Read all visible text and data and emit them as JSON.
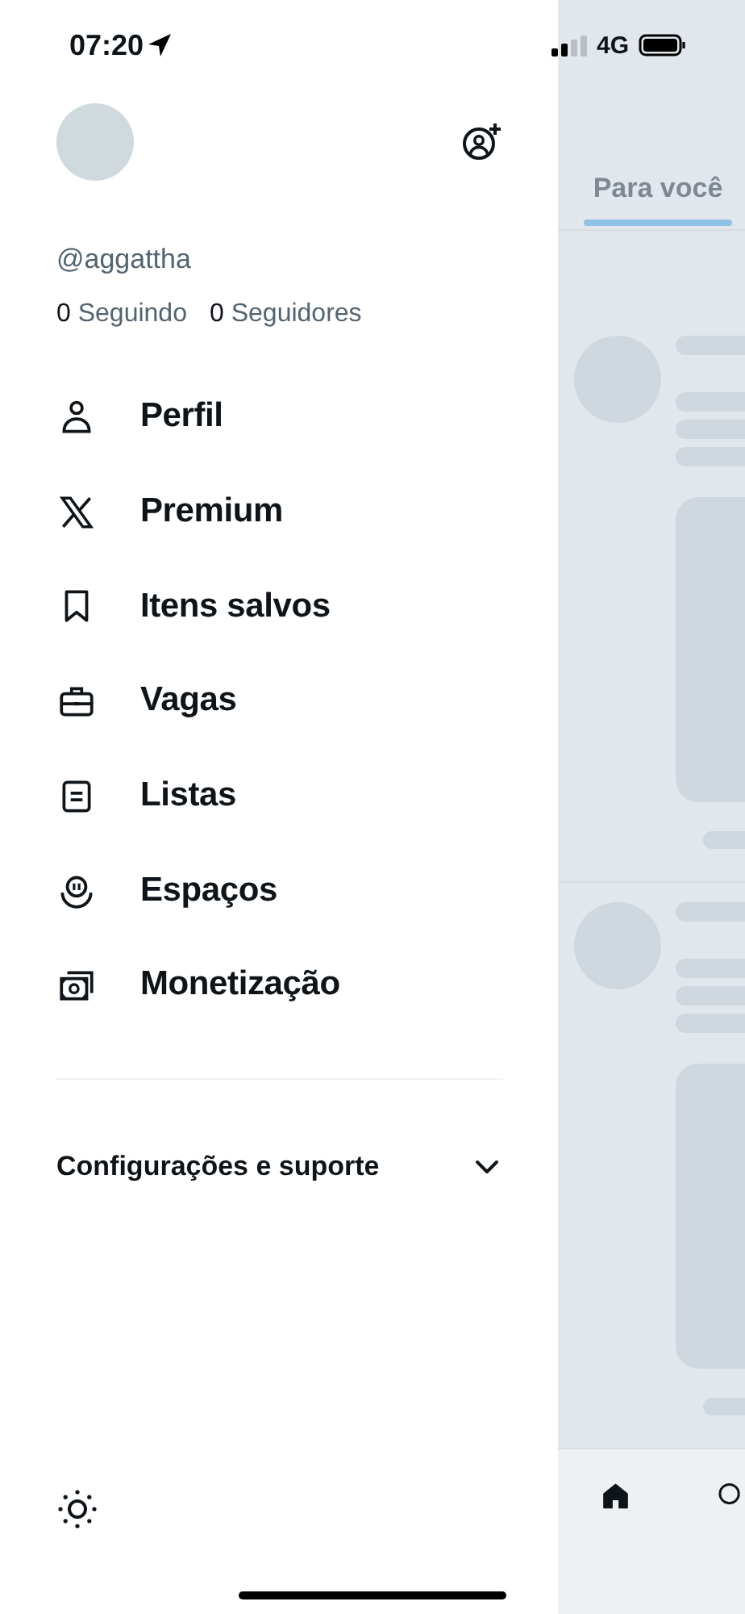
{
  "status_bar": {
    "time": "07:20",
    "network": "4G"
  },
  "profile": {
    "handle": "@aggattha",
    "following": {
      "count": "0",
      "label": "Seguindo"
    },
    "followers": {
      "count": "0",
      "label": "Seguidores"
    }
  },
  "menu": [
    {
      "label": "Perfil",
      "kind": "person"
    },
    {
      "label": "Premium",
      "kind": "x"
    },
    {
      "label": "Itens salvos",
      "kind": "bookmark"
    },
    {
      "label": "Vagas",
      "kind": "briefcase"
    },
    {
      "label": "Listas",
      "kind": "list"
    },
    {
      "label": "Espaços",
      "kind": "spaces"
    },
    {
      "label": "Monetização",
      "kind": "money"
    }
  ],
  "settings_section": {
    "label": "Configurações e suporte",
    "expanded": false
  },
  "feed": {
    "tabs": [
      {
        "label": "Para você",
        "selected": true
      }
    ]
  }
}
